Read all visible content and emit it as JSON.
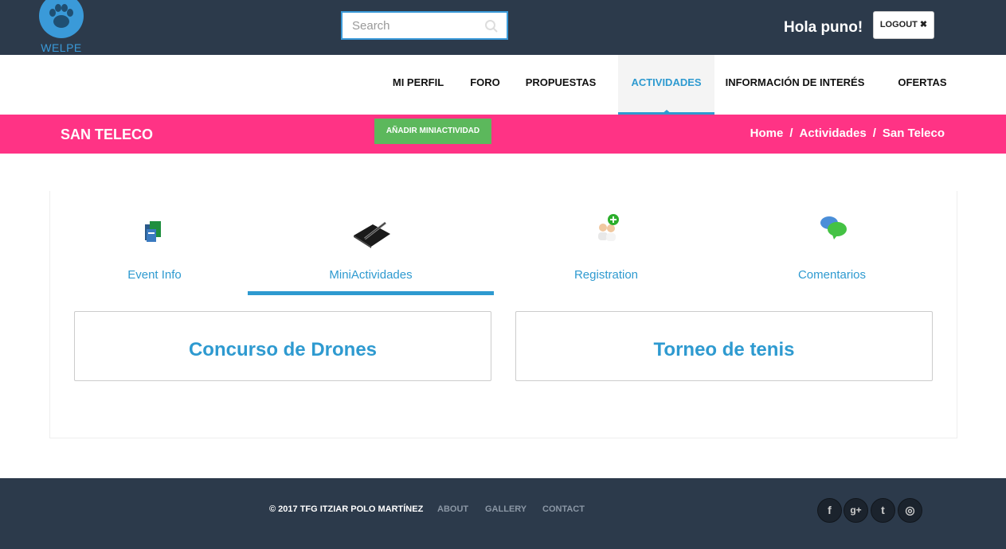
{
  "brand": {
    "name": "WELPE"
  },
  "header": {
    "search_placeholder": "Search",
    "greeting": "Hola puno!",
    "logout_label": "LOGOUT ✖"
  },
  "nav": {
    "items": [
      {
        "label": "MI PERFIL"
      },
      {
        "label": "FORO"
      },
      {
        "label": "PROPUESTAS"
      },
      {
        "label": "ACTIVIDADES"
      },
      {
        "label": "INFORMACIÓN DE INTERÉS"
      },
      {
        "label": "OFERTAS"
      }
    ],
    "active": "ACTIVIDADES"
  },
  "titlebar": {
    "title": "SAN TELECO",
    "add_button": "AÑADIR MINIACTIVIDAD",
    "breadcrumb": [
      "Home",
      "Actividades",
      "San Teleco"
    ],
    "separator": "/"
  },
  "tabs": {
    "items": [
      {
        "label": "Event Info",
        "icon": "event-info-icon"
      },
      {
        "label": "MiniActividades",
        "icon": "notebook-pen-icon"
      },
      {
        "label": "Registration",
        "icon": "add-user-icon"
      },
      {
        "label": "Comentarios",
        "icon": "chat-bubbles-icon"
      }
    ],
    "active": "MiniActividades"
  },
  "cards": [
    {
      "title": "Concurso de Drones"
    },
    {
      "title": "Torneo de tenis"
    }
  ],
  "footer": {
    "copyright": "© 2017 TFG ITZIAR POLO MARTÍNEZ",
    "links": [
      "ABOUT",
      "GALLERY",
      "CONTACT"
    ],
    "social": [
      "f",
      "g+",
      "t",
      "◎"
    ]
  },
  "colors": {
    "header_bg": "#2c3a4b",
    "accent_blue": "#2e9ad0",
    "pink": "#ff3385",
    "green": "#5cb85c"
  }
}
